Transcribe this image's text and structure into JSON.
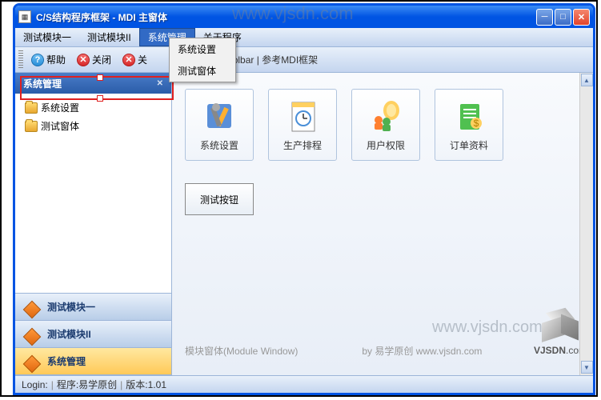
{
  "window": {
    "title": "C/S结构程序框架 - MDI 主窗体"
  },
  "menu": {
    "items": [
      "测试模块一",
      "测试模块II",
      "系统管理",
      "关于程序"
    ],
    "dropdown": [
      "系统设置",
      "测试窗体"
    ]
  },
  "toolbar": {
    "help": "帮助",
    "close": "关闭",
    "closeAll": "关",
    "extra": "oolbar | 参考MDI框架"
  },
  "sidebar": {
    "header": "系统管理",
    "tree": [
      "系统设置",
      "测试窗体"
    ],
    "nav": [
      "测试模块一",
      "测试模块II",
      "系统管理"
    ]
  },
  "main": {
    "cards": [
      "系统设置",
      "生产排程",
      "用户权限",
      "订单资料"
    ],
    "testBtn": "测试按钮",
    "footer1": "模块窗体(Module Window)",
    "footer2": "by 易学原创 www.vjsdn.com"
  },
  "status": {
    "login": "Login:",
    "program": "程序:易学原创",
    "version": "版本:1.01"
  },
  "watermark": "www.vjsdn.com",
  "logo": {
    "text": "VJSDN",
    "suffix": ".com",
    "reg": "®"
  }
}
